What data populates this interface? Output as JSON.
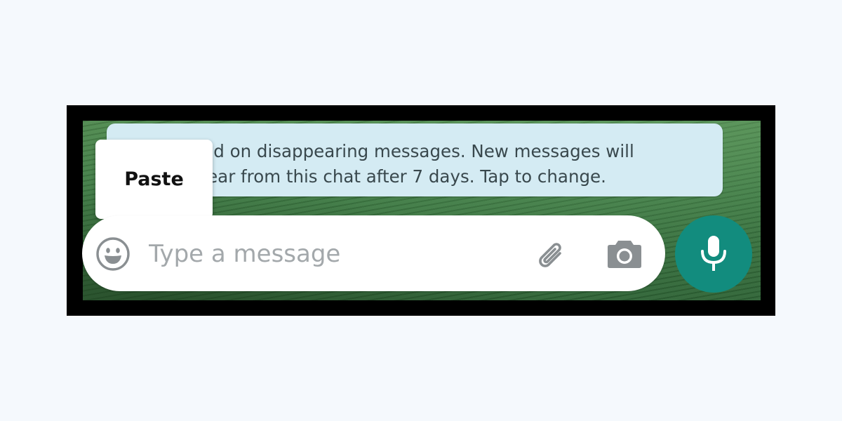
{
  "system_message": {
    "line1": "rned on disappearing messages. New messages will",
    "line2": "ppear from this chat after 7 days. Tap to change."
  },
  "context_menu": {
    "paste_label": "Paste"
  },
  "composer": {
    "placeholder": "Type a message",
    "value": ""
  },
  "icons": {
    "emoji": "emoji-icon",
    "attach": "paperclip-icon",
    "camera": "camera-icon",
    "mic": "microphone-icon"
  },
  "colors": {
    "page_background": "#f5f9fd",
    "frame": "#000000",
    "system_bubble": "#d4ebf3",
    "composer_background": "#ffffff",
    "icon_gray": "#8a8f92",
    "mic_button": "#128c7e"
  }
}
